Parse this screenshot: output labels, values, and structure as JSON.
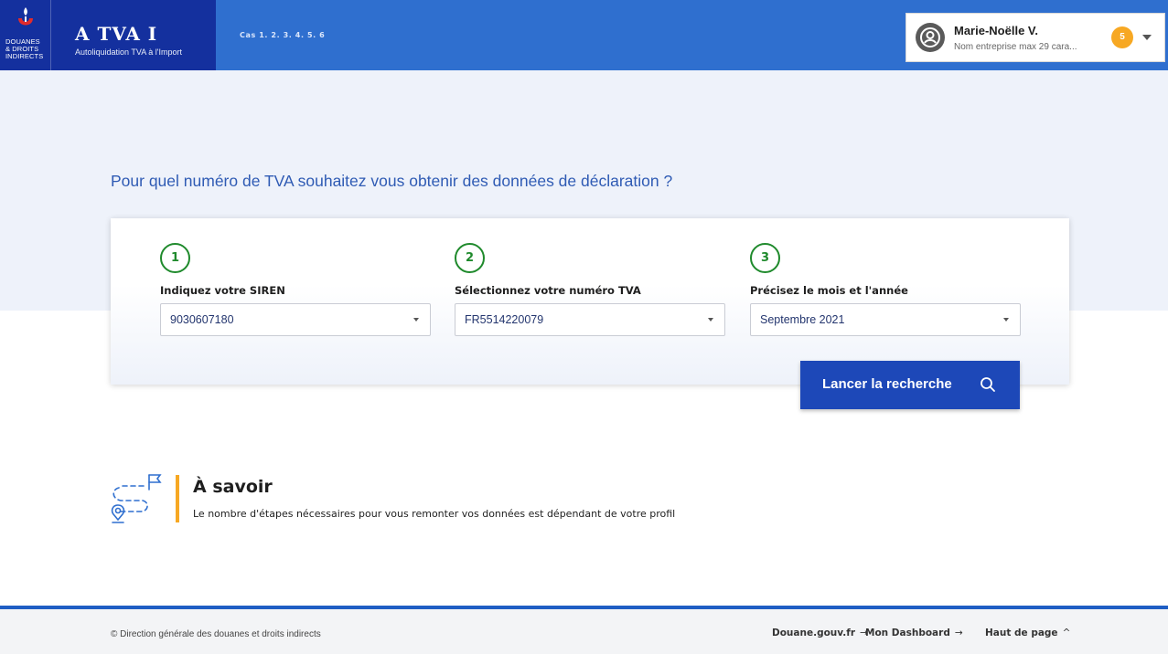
{
  "header": {
    "logo_lines": [
      "DOUANES",
      "& DROITS",
      "INDIRECTS"
    ],
    "app_title": "A TVA I",
    "app_subtitle": "Autoliquidation TVA à l'Import",
    "cases": "Cas 1.  2.  3.  4.  5.  6",
    "colors": {
      "primary": "#2f6fcf",
      "brand_dark": "#14309e"
    }
  },
  "user": {
    "name": "Marie-Noëlle V.",
    "company": "Nom entreprise max 29 cara...",
    "notifications": "5",
    "badge_color": "#f7a823"
  },
  "main": {
    "question": "Pour quel numéro de TVA souhaitez vous obtenir des données de déclaration ?",
    "steps": [
      {
        "number": "1",
        "label": "Indiquez votre SIREN",
        "value": "9030607180"
      },
      {
        "number": "2",
        "label": "Sélectionnez votre numéro TVA",
        "value": "FR5514220079"
      },
      {
        "number": "3",
        "label": "Précisez le mois et l'année",
        "value": "Septembre 2021"
      }
    ],
    "search_label": "Lancer la recherche"
  },
  "info": {
    "title": "À savoir",
    "text": "Le nombre d'étapes nécessaires pour vous remonter vos données est dépendant de votre profil"
  },
  "footer": {
    "copyright": "© Direction générale des douanes et droits indirects",
    "links": [
      {
        "label": "Douane.gouv.fr",
        "arrow": "→"
      },
      {
        "label": "Mon Dashboard",
        "arrow": "→"
      },
      {
        "label": "Haut de page",
        "arrow": "^"
      }
    ]
  }
}
